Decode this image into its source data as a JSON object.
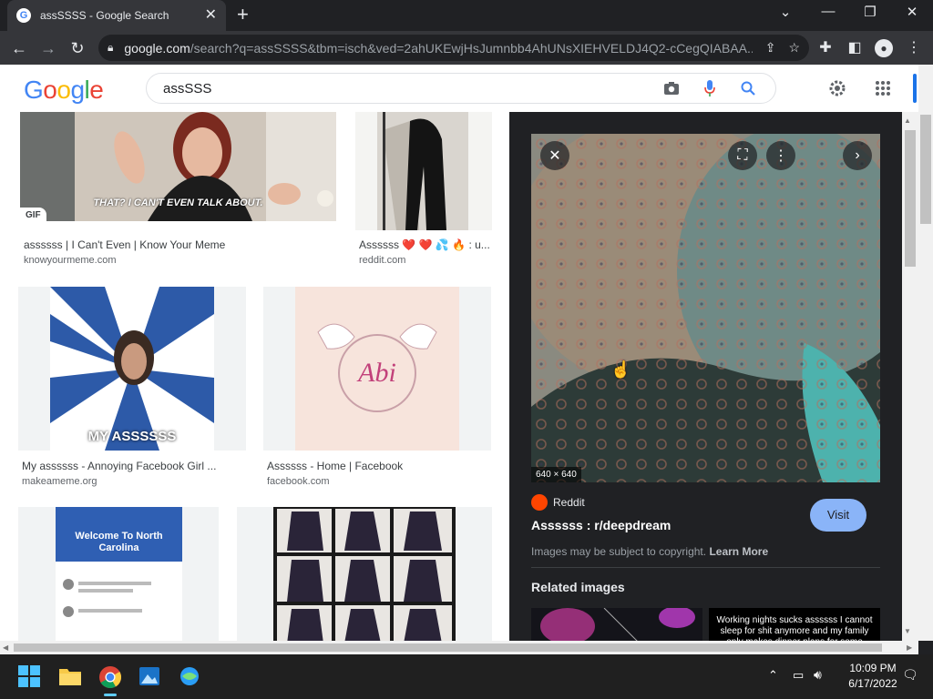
{
  "browser": {
    "tab_title": "assSSSS - Google Search",
    "url_host": "google.com",
    "url_path": "/search?q=assSSSS&tbm=isch&ved=2ahUKEwjHsJumnbb4AhUNsXIEHVELDJ4Q2-cCegQIABAA..."
  },
  "google": {
    "logo_letters": [
      "G",
      "o",
      "o",
      "g",
      "l",
      "e"
    ],
    "search_query": "assSSS"
  },
  "results": [
    {
      "caption": "assssss | I Can't Even | Know Your Meme",
      "domain": "knowyourmeme.com",
      "badge": "GIF",
      "image_text": "THAT? I CAN'T EVEN TALK ABOUT."
    },
    {
      "caption": "Assssss ❤️ ❤️ 💦 🔥 : u...",
      "domain": "reddit.com"
    },
    {
      "caption": "My assssss - Annoying Facebook Girl ...",
      "domain": "makeameme.org",
      "image_text": "MY ASSSSSS"
    },
    {
      "caption": "Assssss - Home | Facebook",
      "domain": "facebook.com",
      "image_text": "Abi"
    },
    {
      "image_text": "Welcome To North Carolina"
    },
    {}
  ],
  "panel": {
    "dimensions": "640 × 640",
    "source_name": "Reddit",
    "title": "Assssss : r/deepdream",
    "visit_label": "Visit",
    "copyright_text": "Images may be subject to copyright.",
    "learn_more": "Learn More",
    "related_heading": "Related images",
    "related_text": "Working nights sucks assssss I cannot sleep for shit anymore and my family only makes dinner plans for some"
  },
  "taskbar": {
    "time": "10:09 PM",
    "date": "6/17/2022"
  },
  "colors": {
    "chrome_dark": "#202124",
    "chrome_toolbar": "#35363a",
    "visit_button": "#8ab4f8",
    "reddit_orange": "#ff4500"
  }
}
